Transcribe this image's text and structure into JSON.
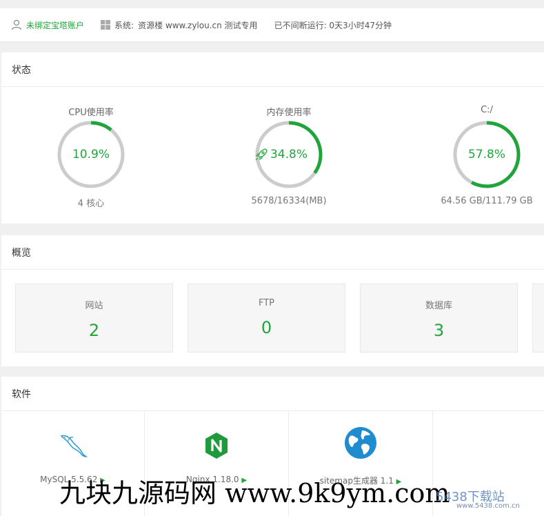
{
  "topbar": {
    "user_label": "未绑定宝塔账户",
    "system_label": "系统:",
    "system_value": "资源楼 www.zylou.cn 测试专用",
    "uptime": "已不间断运行: 0天3小时47分钟"
  },
  "status": {
    "title": "状态",
    "gauges": [
      {
        "label": "CPU使用率",
        "percent": "10.9%",
        "value": 10.9,
        "sub": "4 核心"
      },
      {
        "label": "内存使用率",
        "percent": "34.8%",
        "value": 34.8,
        "sub": "5678/16334(MB)"
      },
      {
        "label": "C:/",
        "percent": "57.8%",
        "value": 57.8,
        "sub": "64.56 GB/111.79 GB"
      }
    ]
  },
  "overview": {
    "title": "概览",
    "cards": [
      {
        "label": "网站",
        "value": "2"
      },
      {
        "label": "FTP",
        "value": "0"
      },
      {
        "label": "数据库",
        "value": "3"
      }
    ]
  },
  "software": {
    "title": "软件",
    "items": [
      {
        "name": "MySQL 5.5.62",
        "icon": "mysql-icon"
      },
      {
        "name": "Nginx 1.18.0",
        "icon": "nginx-icon"
      },
      {
        "name": "sitemap生成器 1.1",
        "icon": "globe-icon"
      }
    ]
  },
  "watermark": {
    "main": "九块九源码网 www.9k9ym.com",
    "logo_text": "5438下载站",
    "logo_url": "www.5438.com.cn"
  },
  "colors": {
    "accent": "#20a53a",
    "track": "#cccccc"
  }
}
